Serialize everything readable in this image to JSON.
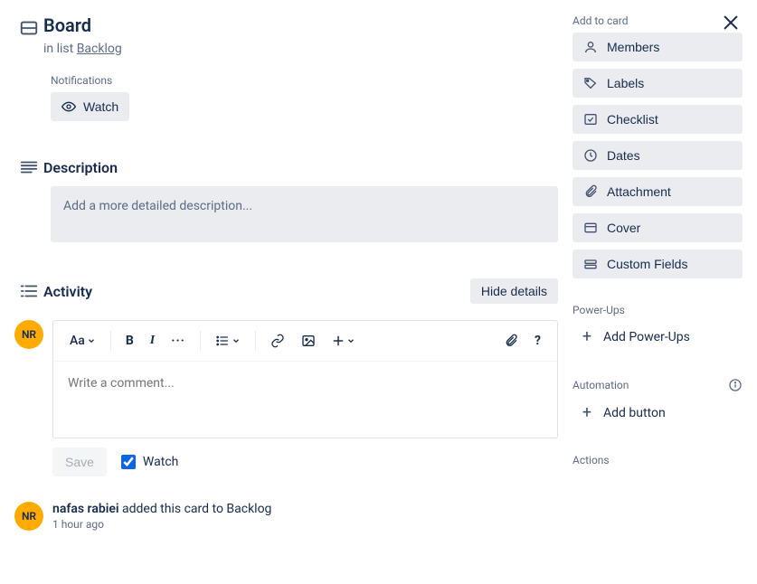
{
  "header": {
    "title": "Board",
    "in_list_prefix": "in list ",
    "list_name": "Backlog"
  },
  "notifications": {
    "label": "Notifications",
    "watch": "Watch"
  },
  "description": {
    "heading": "Description",
    "placeholder": "Add a more detailed description..."
  },
  "activity": {
    "heading": "Activity",
    "hide_details": "Hide details",
    "comment_placeholder": "Write a comment...",
    "save_label": "Save",
    "watch_label": "Watch",
    "avatar_initials": "NR"
  },
  "activity_log": {
    "avatar_initials": "NR",
    "user": "nafas rabiei",
    "action_text": " added this card to Backlog",
    "time": "1 hour ago"
  },
  "sidebar": {
    "add_to_card": "Add to card",
    "members": "Members",
    "labels": "Labels",
    "checklist": "Checklist",
    "dates": "Dates",
    "attachment": "Attachment",
    "cover": "Cover",
    "custom_fields": "Custom Fields",
    "powerups_label": "Power-Ups",
    "add_powerups": "Add Power-Ups",
    "automation_label": "Automation",
    "add_button": "Add button",
    "actions_label": "Actions"
  }
}
